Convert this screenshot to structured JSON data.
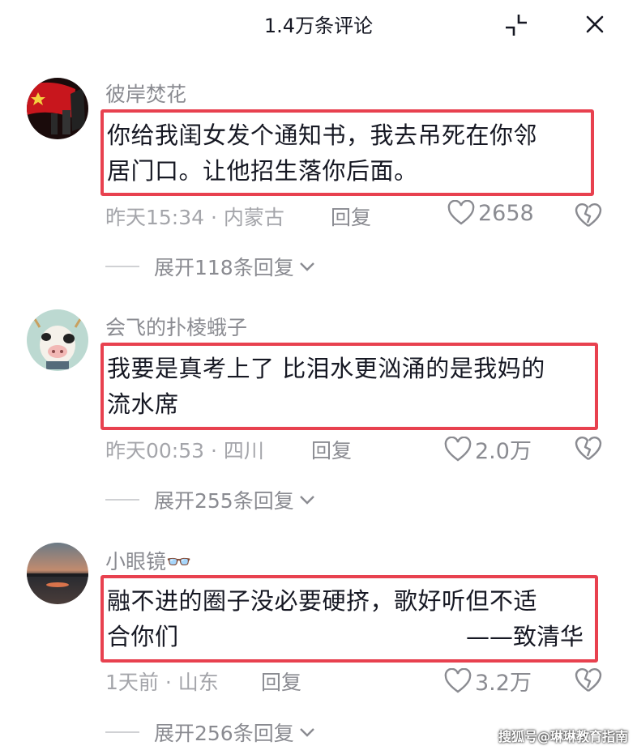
{
  "header": {
    "title": "1.4万条评论"
  },
  "comments": [
    {
      "username": "彼岸焚花",
      "text_lines": [
        "你给我闺女发个通知书，我去吊死在你邻",
        "居门口。让他招生落你后面。"
      ],
      "signature": "",
      "time": "昨天15:34 · 内蒙古",
      "reply_label": "回复",
      "likes": "2658",
      "expand_label": "展开118条回复"
    },
    {
      "username": "会飞的扑棱蛾子",
      "text_lines": [
        "我要是真考上了 比泪水更汹涌的是我妈的",
        "流水席"
      ],
      "signature": "",
      "time": "昨天00:53 · 四川",
      "reply_label": "回复",
      "likes": "2.0万",
      "expand_label": "展开255条回复"
    },
    {
      "username": "小眼镜👓",
      "text_lines": [
        "融不进的圈子没必要硬挤，歌好听但不适",
        "合你们"
      ],
      "signature": "——致清华",
      "time": "1天前 · 山东",
      "reply_label": "回复",
      "likes": "3.2万",
      "expand_label": "展开256条回复"
    }
  ],
  "watermark": "搜狐号@琳琳教育指南",
  "colors": {
    "highlight_border": "#e8414f",
    "muted_text": "#8a8b91"
  }
}
